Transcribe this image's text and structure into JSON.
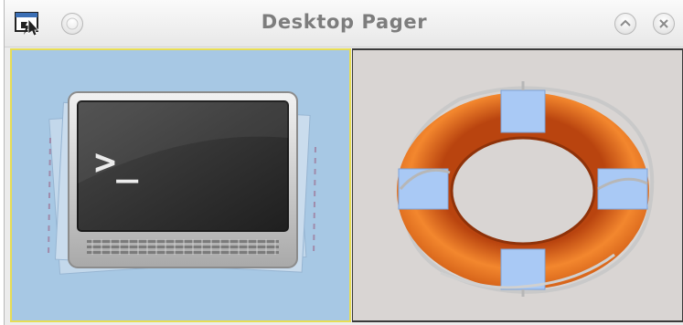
{
  "window": {
    "title": "Desktop Pager",
    "app_icon": "pager-app-icon",
    "menu_button": "circle-button-icon",
    "buttons": {
      "maximize": "chevron-up-icon",
      "close": "close-icon"
    }
  },
  "pager": {
    "desktops": [
      {
        "active": true,
        "app_icon": "terminal-icon"
      },
      {
        "active": false,
        "app_icon": "help-lifebuoy-icon"
      }
    ]
  },
  "colors": {
    "active_desktop_bg": "#a7c8e4",
    "active_desktop_border": "#e7dd55",
    "inactive_desktop_bg": "#d9d5d3",
    "lifebuoy_orange": "#e8671c",
    "lifebuoy_stripe": "#a9c9f5"
  }
}
